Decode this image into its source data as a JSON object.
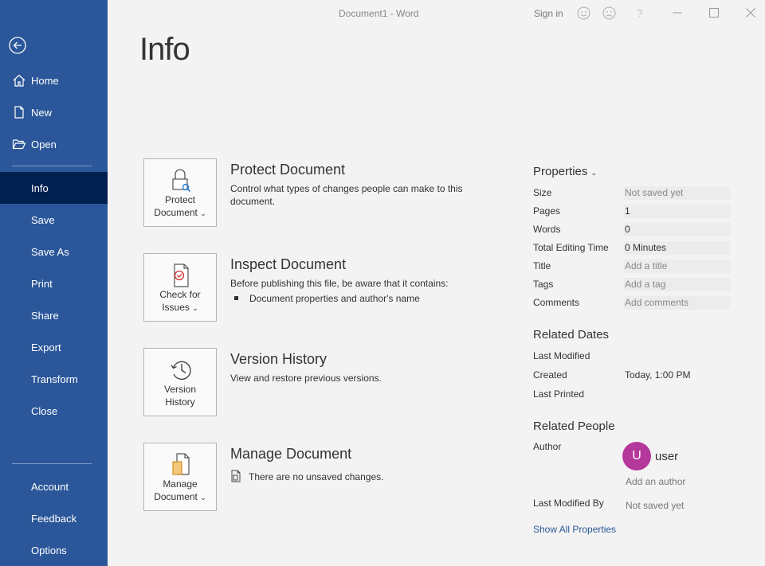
{
  "window": {
    "title": "Document1  -  Word",
    "sign_in": "Sign in"
  },
  "sidebar": {
    "items": [
      {
        "label": "Home"
      },
      {
        "label": "New"
      },
      {
        "label": "Open"
      },
      {
        "label": "Info"
      },
      {
        "label": "Save"
      },
      {
        "label": "Save As"
      },
      {
        "label": "Print"
      },
      {
        "label": "Share"
      },
      {
        "label": "Export"
      },
      {
        "label": "Transform"
      },
      {
        "label": "Close"
      },
      {
        "label": "Account"
      },
      {
        "label": "Feedback"
      },
      {
        "label": "Options"
      }
    ],
    "active": "Info"
  },
  "main": {
    "title": "Info",
    "sections": [
      {
        "tile_line1": "Protect",
        "tile_line2": "Document",
        "heading": "Protect Document",
        "text": "Control what types of changes people can make to this document."
      },
      {
        "tile_line1": "Check for",
        "tile_line2": "Issues",
        "heading": "Inspect Document",
        "text": "Before publishing this file, be aware that it contains:",
        "bullet": "Document properties and author's name"
      },
      {
        "tile_line1": "Version",
        "tile_line2": "History",
        "heading": "Version History",
        "text": "View and restore previous versions."
      },
      {
        "tile_line1": "Manage",
        "tile_line2": "Document",
        "heading": "Manage Document",
        "text": "There are no unsaved changes."
      }
    ]
  },
  "properties": {
    "heading": "Properties",
    "rows": [
      {
        "label": "Size",
        "value": "Not saved yet"
      },
      {
        "label": "Pages",
        "value": "1"
      },
      {
        "label": "Words",
        "value": "0"
      },
      {
        "label": "Total Editing Time",
        "value": "0 Minutes"
      },
      {
        "label": "Title",
        "value": "Add a title"
      },
      {
        "label": "Tags",
        "value": "Add a tag"
      },
      {
        "label": "Comments",
        "value": "Add comments"
      }
    ],
    "related_dates_heading": "Related Dates",
    "dates": [
      {
        "label": "Last Modified",
        "value": ""
      },
      {
        "label": "Created",
        "value": "Today, 1:00 PM"
      },
      {
        "label": "Last Printed",
        "value": ""
      }
    ],
    "related_people_heading": "Related People",
    "author_label": "Author",
    "author_initial": "U",
    "author_name": "user",
    "add_author": "Add an author",
    "last_modified_by_label": "Last Modified By",
    "last_modified_by_value": "Not saved yet",
    "show_all": "Show All Properties"
  },
  "colors": {
    "sidebar": "#2b579a",
    "active": "#002050",
    "avatar": "#b4389b"
  }
}
